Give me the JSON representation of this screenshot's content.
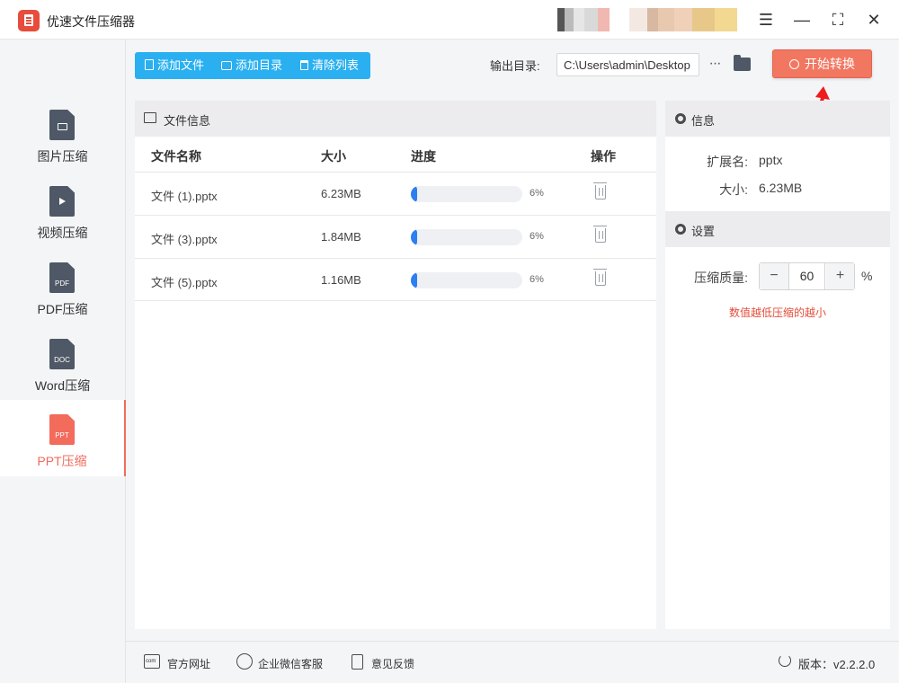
{
  "app": {
    "title": "优速文件压缩器"
  },
  "sidebar": {
    "items": [
      {
        "label": "图片压缩",
        "icon": "image-file-icon"
      },
      {
        "label": "视频压缩",
        "icon": "video-file-icon"
      },
      {
        "label": "PDF压缩",
        "icon": "pdf-file-icon",
        "badge": "PDF"
      },
      {
        "label": "Word压缩",
        "icon": "doc-file-icon",
        "badge": "DOC"
      },
      {
        "label": "PPT压缩",
        "icon": "ppt-file-icon",
        "badge": "PPT",
        "active": true
      }
    ]
  },
  "toolbar": {
    "add_file": "添加文件",
    "add_dir": "添加目录",
    "clear_list": "清除列表",
    "output_label": "输出目录:",
    "output_path": "C:\\Users\\admin\\Desktop",
    "more": "···",
    "start": "开始转换"
  },
  "file_panel": {
    "title": "文件信息",
    "columns": {
      "name": "文件名称",
      "size": "大小",
      "progress": "进度",
      "action": "操作"
    },
    "rows": [
      {
        "name": "文件 (1).pptx",
        "size": "6.23MB",
        "progress": 0.06,
        "percent": "6%"
      },
      {
        "name": "文件 (3).pptx",
        "size": "1.84MB",
        "progress": 0.06,
        "percent": "6%"
      },
      {
        "name": "文件 (5).pptx",
        "size": "1.16MB",
        "progress": 0.06,
        "percent": "6%"
      }
    ]
  },
  "info": {
    "title": "信息",
    "ext_label": "扩展名:",
    "ext_value": "pptx",
    "size_label": "大小:",
    "size_value": "6.23MB"
  },
  "settings": {
    "title": "设置",
    "quality_label": "压缩质量:",
    "minus": "−",
    "quality_value": "60",
    "plus": "+",
    "unit": "%",
    "hint": "数值越低压缩的越小"
  },
  "footer": {
    "website": "官方网址",
    "wechat": "企业微信客服",
    "feedback": "意见反馈",
    "version": "版本：v2.2.2.0"
  },
  "colors": {
    "accent": "#f27761",
    "toolbar_blue": "#2ab0f0",
    "progress": "#2c7ff2",
    "hint": "#e44d3a"
  }
}
